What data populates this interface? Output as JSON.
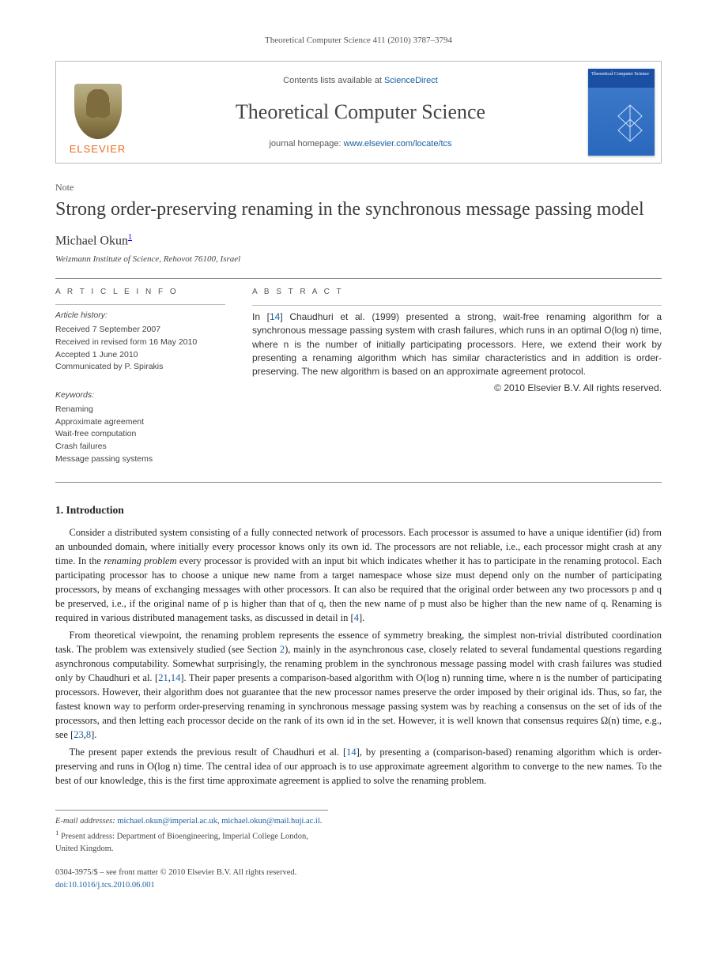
{
  "running_head": "Theoretical Computer Science 411 (2010) 3787–3794",
  "masthead": {
    "contents_prefix": "Contents lists available at ",
    "contents_link": "ScienceDirect",
    "journal": "Theoretical Computer Science",
    "homepage_prefix": "journal homepage: ",
    "homepage_link": "www.elsevier.com/locate/tcs",
    "publisher": "ELSEVIER",
    "cover_title": "Theoretical Computer Science"
  },
  "article": {
    "type_label": "Note",
    "title": "Strong order-preserving renaming in the synchronous message passing model",
    "author": "Michael Okun",
    "author_marker": "1",
    "affiliation": "Weizmann Institute of Science, Rehovot 76100, Israel"
  },
  "info": {
    "heading": "A R T I C L E   I N F O",
    "history_label": "Article history:",
    "received": "Received 7 September 2007",
    "revised": "Received in revised form 16 May 2010",
    "accepted": "Accepted 1 June 2010",
    "communicated": "Communicated by P. Spirakis",
    "keywords_label": "Keywords:",
    "keywords": [
      "Renaming",
      "Approximate agreement",
      "Wait-free computation",
      "Crash failures",
      "Message passing systems"
    ]
  },
  "abstract": {
    "heading": "A B S T R A C T",
    "text_pre": "In [",
    "ref": "14",
    "text_post": "] Chaudhuri et al. (1999) presented a strong, wait-free renaming algorithm for a synchronous message passing system with crash failures, which runs in an optimal O(log n) time, where n is the number of initially participating processors. Here, we extend their work by presenting a renaming algorithm which has similar characteristics and in addition is order-preserving. The new algorithm is based on an approximate agreement protocol.",
    "copyright": "© 2010 Elsevier B.V. All rights reserved."
  },
  "sections": {
    "intro_heading": "1. Introduction",
    "p1_a": "Consider a distributed system consisting of a fully connected network of processors. Each processor is assumed to have a unique identifier (id) from an unbounded domain, where initially every processor knows only its own id. The processors are not reliable, i.e., each processor might crash at any time. In the ",
    "p1_em": "renaming problem",
    "p1_b": " every processor is provided with an input bit which indicates whether it has to participate in the renaming protocol. Each participating processor has to choose a unique new name from a target namespace whose size must depend only on the number of participating processors, by means of exchanging messages with other processors. It can also be required that the original order between any two processors p and q be preserved, i.e., if the original name of p is higher than that of q, then the new name of p must also be higher than the new name of q. Renaming is required in various distributed management tasks, as discussed in detail in [",
    "p1_ref": "4",
    "p1_c": "].",
    "p2_a": "From theoretical viewpoint, the renaming problem represents the essence of symmetry breaking, the simplest non-trivial distributed coordination task. The problem was extensively studied (see Section ",
    "p2_ref1": "2",
    "p2_b": "), mainly in the asynchronous case, closely related to several fundamental questions regarding asynchronous computability. Somewhat surprisingly, the renaming problem in the synchronous message passing model with crash failures was studied only by Chaudhuri et al. [",
    "p2_ref2": "21",
    "p2_ref3": "14",
    "p2_c": "]. Their paper presents a comparison-based algorithm with O(log n) running time, where n is the number of participating processors. However, their algorithm does not guarantee that the new processor names preserve the order imposed by their original ids. Thus, so far, the fastest known way to perform order-preserving renaming in synchronous message passing system was by reaching a consensus on the set of ids of the processors, and then letting each processor decide on the rank of its own id in the set. However, it is well known that consensus requires Ω(n) time, e.g., see [",
    "p2_ref4": "23",
    "p2_ref5": "8",
    "p2_d": "].",
    "p3_a": "The present paper extends the previous result of Chaudhuri et al. [",
    "p3_ref": "14",
    "p3_b": "], by presenting a (comparison-based) renaming algorithm which is order-preserving and runs in O(log n) time. The central idea of our approach is to use approximate agreement algorithm to converge to the new names. To the best of our knowledge, this is the first time approximate agreement is applied to solve the renaming problem."
  },
  "footnotes": {
    "email_label": "E-mail addresses:",
    "email1": "michael.okun@imperial.ac.uk",
    "email_sep": ", ",
    "email2": "michael.okun@mail.huji.ac.il",
    "email_end": ".",
    "note_marker": "1",
    "note_text": " Present address: Department of Bioengineering, Imperial College London, United Kingdom."
  },
  "footer": {
    "line1": "0304-3975/$ – see front matter © 2010 Elsevier B.V. All rights reserved.",
    "doi_label": "doi:",
    "doi": "10.1016/j.tcs.2010.06.001"
  }
}
